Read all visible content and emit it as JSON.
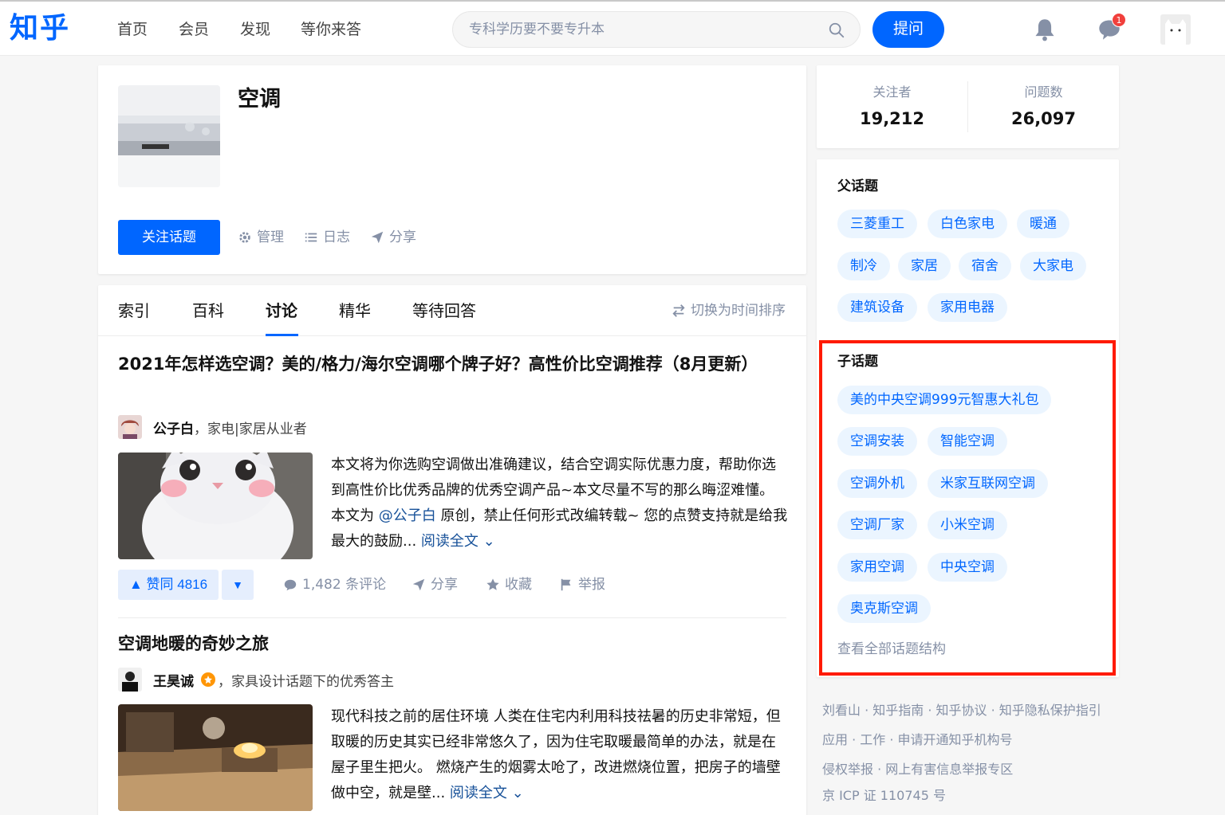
{
  "header": {
    "logo": "知乎",
    "nav": [
      "首页",
      "会员",
      "发现",
      "等你来答"
    ],
    "search_placeholder": "专科学历要不要专升本",
    "ask_label": "提问",
    "message_badge": "1"
  },
  "topic": {
    "title": "空调",
    "follow_label": "关注话题",
    "manage_label": "管理",
    "log_label": "日志",
    "share_label": "分享"
  },
  "tabs": {
    "items": [
      "索引",
      "百科",
      "讨论",
      "精华",
      "等待回答"
    ],
    "active": "讨论",
    "sort_label": "切换为时间排序"
  },
  "articles": [
    {
      "title": "2021年怎样选空调？美的/格力/海尔空调哪个牌子好？高性价比空调推荐（8月更新）",
      "author": "公子白",
      "author_desc": "，家电|家居从业者",
      "excerpt_before": "本文将为你选购空调做出准确建议，结合空调实际优惠力度，帮助你选到高性价比优秀品牌的优秀空调产品~本文尽量不写的那么晦涩难懂。 本文为 ",
      "excerpt_mention": "@公子白",
      "excerpt_after": " 原创，禁止任何形式改编转载~ 您的点赞支持就是给我最大的鼓励...",
      "read_more": "阅读全文",
      "vote_label": "▲ 赞同 4816",
      "comments": "1,482 条评论",
      "share": "分享",
      "collect": "收藏",
      "report": "举报"
    },
    {
      "title": "空调地暖的奇妙之旅",
      "author": "王昊诚",
      "author_desc": "，家具设计话题下的优秀答主",
      "excerpt": "现代科技之前的居住环境 人类在住宅内利用科技祛暑的历史非常短，但取暖的历史其实已经非常悠久了，因为住宅取暖最简单的办法，就是在屋子里生把火。 燃烧产生的烟雾太呛了，改进燃烧位置，把房子的墙壁做中空，就是壁...",
      "read_more": "阅读全文"
    }
  ],
  "stats": {
    "followers_label": "关注者",
    "followers": "19,212",
    "questions_label": "问题数",
    "questions": "26,097"
  },
  "parent_topics": {
    "title": "父话题",
    "items": [
      "三菱重工",
      "白色家电",
      "暖通",
      "制冷",
      "家居",
      "宿舍",
      "大家电",
      "建筑设备",
      "家用电器"
    ]
  },
  "child_topics": {
    "title": "子话题",
    "items": [
      "美的中央空调999元智惠大礼包",
      "空调安装",
      "智能空调",
      "空调外机",
      "米家互联网空调",
      "空调厂家",
      "小米空调",
      "家用空调",
      "中央空调",
      "奥克斯空调"
    ],
    "see_all": "查看全部话题结构"
  },
  "footer": {
    "line1": "刘看山 · 知乎指南 · 知乎协议 · 知乎隐私保护指引",
    "line2": "应用 · 工作 · 申请开通知乎机构号",
    "line3": "侵权举报 · 网上有害信息举报专区",
    "line4": "京 ICP 证 110745 号"
  },
  "colors": {
    "brand": "#0066ff",
    "highlight": "#ff1a00",
    "pill_bg": "#ebf5ff",
    "muted": "#8590a6"
  }
}
